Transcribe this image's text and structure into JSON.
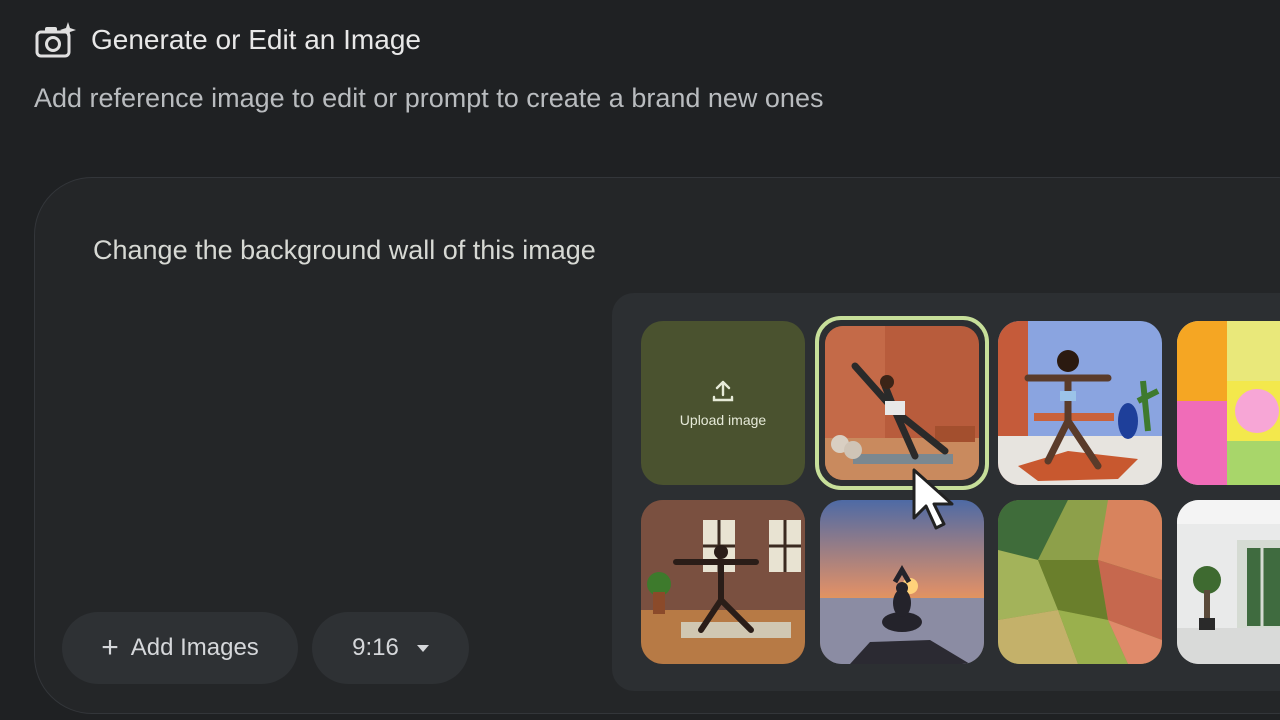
{
  "header": {
    "title": "Generate or Edit an Image",
    "subtitle": "Add reference image to edit or prompt to create a brand new ones",
    "icon": "camera-sparkle-icon"
  },
  "prompt": {
    "text": "Change the background wall of this image"
  },
  "controls": {
    "add_images_label": "Add Images",
    "aspect_ratio_value": "9:16"
  },
  "image_picker": {
    "upload_label": "Upload image",
    "selected_index": 1,
    "images": [
      "yoga triangle pose, terracotta wall",
      "yoga warrior pose, blue wall",
      "abstract colorful pattern",
      "yoga warrior pose, brick loft",
      "meditation at sunset",
      "abstract green and red shapes",
      "bright white interior with plant"
    ]
  },
  "colors": {
    "background": "#1f2123",
    "panel": "#242628",
    "upload_tile": "#4a522f",
    "selection_ring": "#c7df9a"
  }
}
